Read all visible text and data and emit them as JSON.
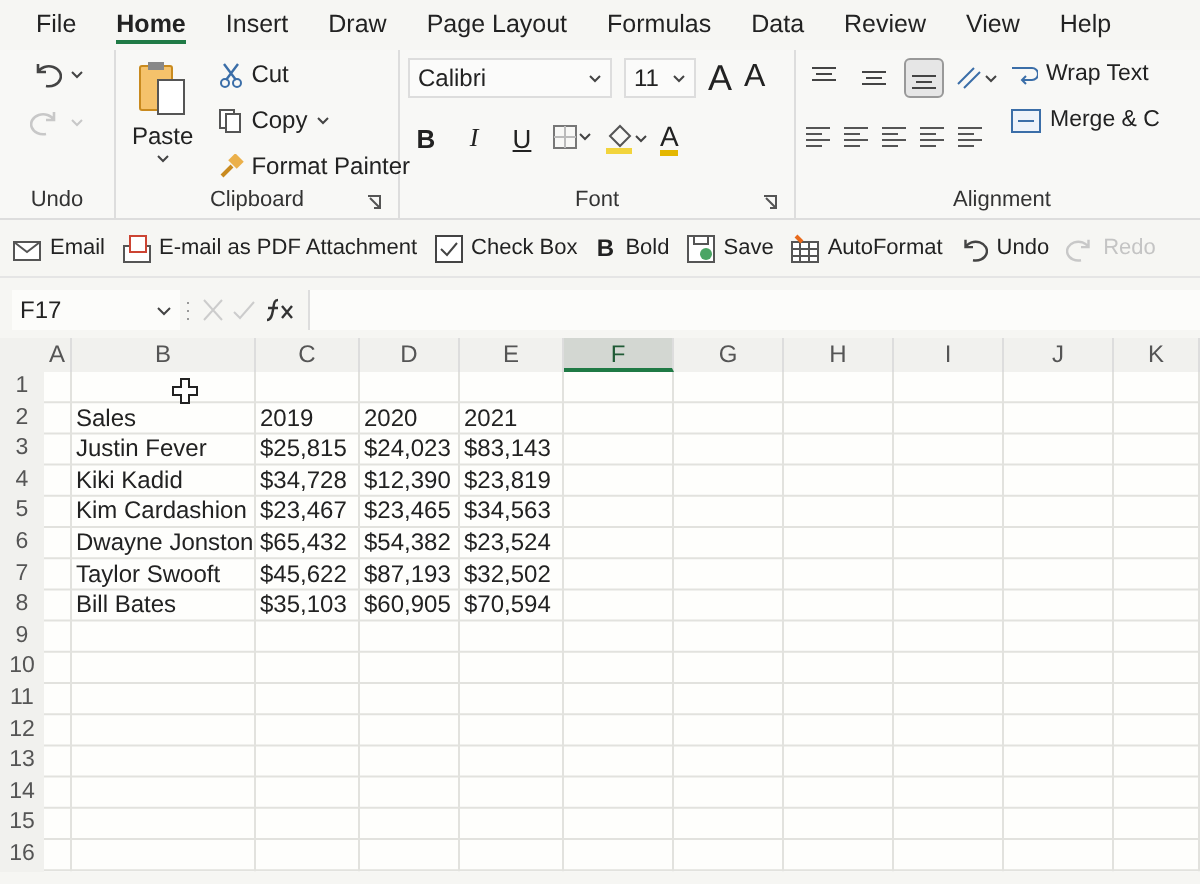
{
  "menu_tabs": [
    {
      "label": "File",
      "selected": false
    },
    {
      "label": "Home",
      "selected": true
    },
    {
      "label": "Insert",
      "selected": false
    },
    {
      "label": "Draw",
      "selected": false
    },
    {
      "label": "Page Layout",
      "selected": false
    },
    {
      "label": "Formulas",
      "selected": false
    },
    {
      "label": "Data",
      "selected": false
    },
    {
      "label": "Review",
      "selected": false
    },
    {
      "label": "View",
      "selected": false
    },
    {
      "label": "Help",
      "selected": false
    }
  ],
  "ribbon": {
    "undo": {
      "label": "Undo",
      "redo_disabled": true
    },
    "clipboard": {
      "paste": "Paste",
      "cut": "Cut",
      "copy": "Copy",
      "format_painter": "Format Painter",
      "label": "Clipboard"
    },
    "font": {
      "font_name": "Calibri",
      "font_size": "11",
      "grow": "A",
      "shrink": "A",
      "styles": [
        "B",
        "I",
        "U"
      ],
      "font_color": "A",
      "label": "Font"
    },
    "alignment": {
      "vertical": [
        {
          "selected": false
        },
        {
          "selected": false
        },
        {
          "selected": true
        }
      ],
      "wrap_text": "Wrap Text",
      "merge": "Merge & C",
      "label": "Alignment"
    }
  },
  "quick_toolbar": [
    {
      "kind": "mail",
      "label": "Email",
      "disabled": false
    },
    {
      "kind": "pdf",
      "label": "E-mail as PDF Attachment",
      "disabled": false
    },
    {
      "kind": "checkbox",
      "label": "Check Box",
      "disabled": false
    },
    {
      "kind": "glyph",
      "glyph": "B",
      "label": "Bold",
      "disabled": false
    },
    {
      "kind": "save",
      "label": "Save",
      "disabled": false
    },
    {
      "kind": "table",
      "label": "AutoFormat",
      "disabled": false
    },
    {
      "kind": "undo",
      "label": "Undo",
      "disabled": false
    },
    {
      "kind": "redo",
      "label": "Redo",
      "disabled": true
    }
  ],
  "formula_bar": {
    "name_box": "F17"
  },
  "sheet": {
    "columns": [
      {
        "label": "A",
        "selected": false
      },
      {
        "label": "B",
        "selected": false
      },
      {
        "label": "C",
        "selected": false
      },
      {
        "label": "D",
        "selected": false
      },
      {
        "label": "E",
        "selected": false
      },
      {
        "label": "F",
        "selected": true
      },
      {
        "label": "G",
        "selected": false
      },
      {
        "label": "H",
        "selected": false
      },
      {
        "label": "I",
        "selected": false
      },
      {
        "label": "J",
        "selected": false
      },
      {
        "label": "K",
        "selected": false
      }
    ],
    "rows": [
      {
        "number": "1"
      },
      {
        "number": "2",
        "cells": [
          "Sales",
          "2019",
          "2020",
          "2021"
        ]
      },
      {
        "number": "3",
        "cells": [
          "Justin Fever",
          "$25,815",
          "$24,023",
          "$83,143"
        ]
      },
      {
        "number": "4",
        "cells": [
          "Kiki Kadid",
          "$34,728",
          "$12,390",
          "$23,819"
        ]
      },
      {
        "number": "5",
        "cells": [
          "Kim Cardashion",
          "$23,467",
          "$23,465",
          "$34,563"
        ]
      },
      {
        "number": "6",
        "cells": [
          "Dwayne Jonston",
          "$65,432",
          "$54,382",
          "$23,524"
        ]
      },
      {
        "number": "7",
        "cells": [
          "Taylor Swooft",
          "$45,622",
          "$87,193",
          "$32,502"
        ]
      },
      {
        "number": "8",
        "cells": [
          "Bill Bates",
          "$35,103",
          "$60,905",
          "$70,594"
        ]
      },
      {
        "number": "9"
      },
      {
        "number": "10"
      },
      {
        "number": "11"
      },
      {
        "number": "12"
      },
      {
        "number": "13"
      },
      {
        "number": "14"
      },
      {
        "number": "15"
      },
      {
        "number": "16"
      }
    ]
  }
}
